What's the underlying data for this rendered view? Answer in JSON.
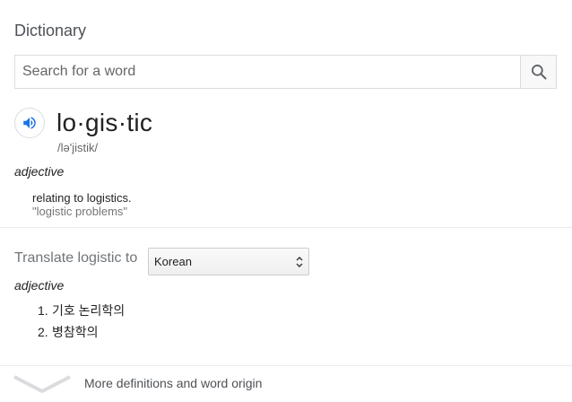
{
  "header": {
    "title": "Dictionary"
  },
  "search": {
    "placeholder": "Search for a word",
    "value": "",
    "button_icon": "search-icon"
  },
  "entry": {
    "speaker_icon": "speaker-icon",
    "headword": "lo·gis·tic",
    "phonetic": "/lə'jistik/",
    "part_of_speech": "adjective",
    "definition": "relating to logistics.",
    "example": "\"logistic problems\""
  },
  "translate": {
    "label": "Translate logistic to",
    "selected_language": "Korean",
    "part_of_speech": "adjective",
    "items": [
      {
        "number": "1.",
        "text": "기호 논리학의"
      },
      {
        "number": "2.",
        "text": "병참학의"
      }
    ]
  },
  "footer": {
    "more_label": "More definitions and word origin",
    "chevron_icon": "chevron-down-icon"
  },
  "colors": {
    "accent": "#1a73e8",
    "muted_text": "#70757a",
    "divider": "#ebebeb"
  }
}
